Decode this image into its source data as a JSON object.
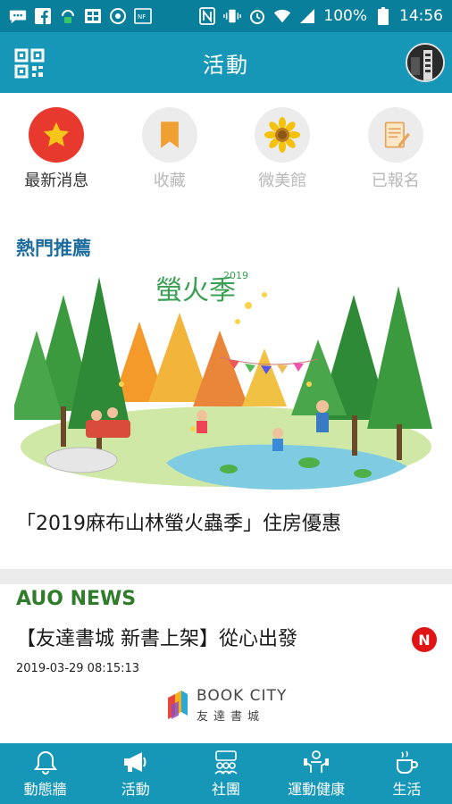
{
  "status_bar": {
    "battery": "100%",
    "time": "14:56",
    "icons": [
      "message-icon",
      "facebook-icon",
      "vpn-icon",
      "gallery-icon",
      "rotate-icon",
      "nfc-icon",
      "nfc-n-icon",
      "vibrate-icon",
      "alarm-icon",
      "wifi-icon",
      "signal-icon",
      "battery-icon"
    ]
  },
  "app_bar": {
    "title": "活動",
    "left_icon": "qr-code-icon",
    "right_icon": "avatar"
  },
  "categories": [
    {
      "label": "最新消息",
      "icon": "star-icon",
      "active": true,
      "color": "#e8392e"
    },
    {
      "label": "收藏",
      "icon": "bookmark-icon",
      "active": false,
      "color": "#f0a033"
    },
    {
      "label": "微美館",
      "icon": "sunflower-icon",
      "active": false,
      "color": "#f4c20d"
    },
    {
      "label": "已報名",
      "icon": "notepad-icon",
      "active": false,
      "color": "#e7a55c"
    }
  ],
  "hot": {
    "section_title": "熱門推薦",
    "banner_title": "螢火季",
    "banner_year": "2019",
    "caption": "「2019麻布山林螢火蟲季」住房優惠"
  },
  "news": {
    "section_title": "AUO NEWS",
    "title": "【友達書城 新書上架】從心出發",
    "badge": "N",
    "date": "2019-03-29 08:15:13",
    "logo_en": "BOOK CITY",
    "logo_zh": "友達書城"
  },
  "bottom_nav": [
    {
      "label": "動態牆",
      "icon": "bell-icon"
    },
    {
      "label": "活動",
      "icon": "megaphone-icon"
    },
    {
      "label": "社團",
      "icon": "group-icon"
    },
    {
      "label": "運動健康",
      "icon": "fitness-icon"
    },
    {
      "label": "生活",
      "icon": "coffee-icon"
    }
  ],
  "colors": {
    "status_bar": "#0a7f9b",
    "app_bar": "#1797b7",
    "section_blue": "#1f6d9e",
    "news_green": "#2f7d2a",
    "badge_red": "#e01414"
  }
}
